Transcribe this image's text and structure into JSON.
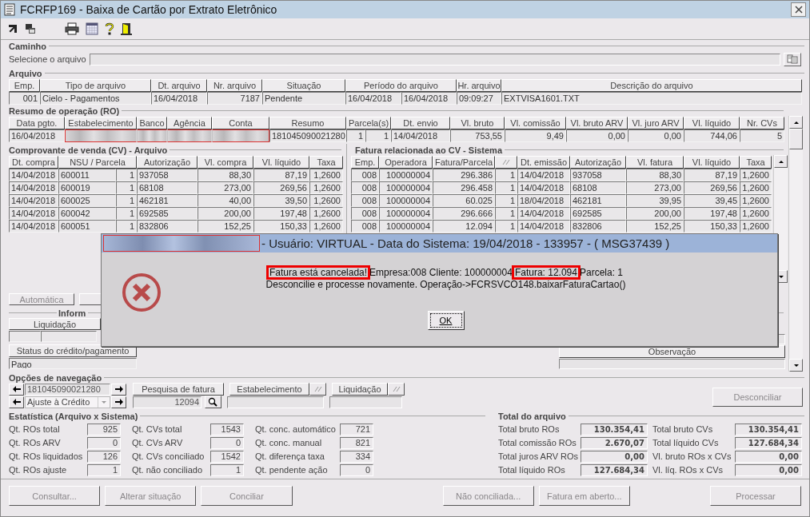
{
  "window": {
    "title": "FCRFP169 - Baixa de Cartão por Extrato Eletrônico"
  },
  "caminho": {
    "title": "Caminho",
    "label": "Selecione o arquivo"
  },
  "arquivo": {
    "title": "Arquivo",
    "columns": [
      "Emp.",
      "Tipo de arquivo",
      "Dt. arquivo",
      "Nr. arquivo",
      "Situação",
      "Período do arquivo",
      "Hr. arquivo",
      "Descrição do arquivo"
    ],
    "row": [
      "001",
      "Cielo - Pagamentos",
      "16/04/2018",
      "7187",
      "Pendente",
      [
        "16/04/2018",
        "16/04/2018"
      ],
      "09:09:27",
      "EXTVISA1601.TXT"
    ]
  },
  "resumo": {
    "title": "Resumo de operação (RO)",
    "columns": [
      "Data pgto.",
      "Estabelecimento",
      "Banco",
      "Agência",
      "Conta",
      "Resumo",
      "Parcela(s)",
      "Dt. envio",
      "Vl. bruto",
      "Vl. comissão",
      "Vl. bruto ARV",
      "Vl. juro ARV",
      "Vl. líquido",
      "Nr. CVs"
    ],
    "row": [
      {
        "kind": "text",
        "text": "16/04/2018"
      },
      {
        "kind": "redacted"
      },
      {
        "kind": "redacted"
      },
      {
        "kind": "redacted"
      },
      {
        "kind": "redacted"
      },
      {
        "kind": "text",
        "text": "181045090021280"
      },
      {
        "kind": "pair",
        "texts": [
          "1",
          "1"
        ]
      },
      {
        "kind": "text",
        "text": "14/04/2018"
      },
      {
        "kind": "text",
        "text": "753,55"
      },
      {
        "kind": "text",
        "text": "9,49"
      },
      {
        "kind": "text",
        "text": "0,00"
      },
      {
        "kind": "text",
        "text": "0,00"
      },
      {
        "kind": "text",
        "text": "744,06"
      },
      {
        "kind": "text",
        "text": "5"
      }
    ]
  },
  "cv": {
    "title": "Comprovante de venda (CV) - Arquivo",
    "columns": [
      "Dt. compra",
      "NSU / Parcela",
      "Autorização",
      "Vl. compra",
      "Vl. líquido",
      "Taxa"
    ],
    "rows": [
      [
        "14/04/2018",
        [
          "600011",
          "1"
        ],
        "937058",
        "88,30",
        "87,19",
        "1,2600"
      ],
      [
        "14/04/2018",
        [
          "600019",
          "1"
        ],
        "68108",
        "273,00",
        "269,56",
        "1,2600"
      ],
      [
        "14/04/2018",
        [
          "600025",
          "1"
        ],
        "462181",
        "40,00",
        "39,50",
        "1,2600"
      ],
      [
        "14/04/2018",
        [
          "600042",
          "1"
        ],
        "692585",
        "200,00",
        "197,48",
        "1,2600"
      ],
      [
        "14/04/2018",
        [
          "600051",
          "1"
        ],
        "832806",
        "152,25",
        "150,33",
        "1,2600"
      ]
    ]
  },
  "fatura": {
    "title": "Fatura relacionada ao CV - Sistema",
    "columns": [
      {
        "kind": "text",
        "label": "Emp."
      },
      {
        "kind": "text",
        "label": "Operadora"
      },
      {
        "kind": "text",
        "label": "Fatura/Parcela"
      },
      {
        "kind": "icon"
      },
      {
        "kind": "text",
        "label": "Dt. emissão"
      },
      {
        "kind": "text",
        "label": "Autorização"
      },
      {
        "kind": "text",
        "label": "Vl. fatura"
      },
      {
        "kind": "text",
        "label": "Vl. líquido"
      },
      {
        "kind": "text",
        "label": "Taxa"
      }
    ],
    "rows": [
      [
        "008",
        "100000004",
        "296.386",
        "1",
        "14/04/2018",
        "937058",
        "88,30",
        "87,19",
        "1,2600"
      ],
      [
        "008",
        "100000004",
        "296.458",
        "1",
        "14/04/2018",
        "68108",
        "273,00",
        "269,56",
        "1,2600"
      ],
      [
        "008",
        "100000004",
        "60.025",
        "1",
        "18/04/2018",
        "462181",
        "39,95",
        "39,45",
        "1,2600"
      ],
      [
        "008",
        "100000004",
        "296.666",
        "1",
        "14/04/2018",
        "692585",
        "200,00",
        "197,48",
        "1,2600"
      ],
      [
        "008",
        "100000004",
        "12.094",
        "1",
        "14/04/2018",
        "832806",
        "152,25",
        "150,33",
        "1,2600"
      ]
    ]
  },
  "automatica": {
    "label": "Automática",
    "disabled": true
  },
  "informacoes": {
    "title": "Inform",
    "liquidacao": "Liquidação",
    "status_header": "Status do crédito/pagamento",
    "status_value": "Pago",
    "observacao": "Observação"
  },
  "navegacao": {
    "title": "Opções de navegação",
    "resumo_value": "181045090021280",
    "tipo_value": "Ajuste à Crédito",
    "pesquisa_label": "Pesquisa de fatura",
    "pesquisa_value": "12094",
    "estabelecimento_label": "Estabelecimento",
    "liquidacao_label": "Liquidação"
  },
  "desconciliar": {
    "label": "Desconciliar",
    "disabled": true
  },
  "estatistica": {
    "title": "Estatística (Arquivo x Sistema)",
    "columns": [
      [
        {
          "label": "Qt. ROs total",
          "value": "925"
        },
        {
          "label": "Qt. ROs ARV",
          "value": "0"
        },
        {
          "label": "Qt. ROs liquidados",
          "value": "126"
        },
        {
          "label": "Qt. ROs ajuste",
          "value": "1"
        }
      ],
      [
        {
          "label": "Qt. CVs total",
          "value": "1543"
        },
        {
          "label": "Qt. CVs ARV",
          "value": "0"
        },
        {
          "label": "Qt. CVs conciliado",
          "value": "1542"
        },
        {
          "label": "Qt. não conciliado",
          "value": "1"
        }
      ],
      [
        {
          "label": "Qt. conc. automático",
          "value": "721"
        },
        {
          "label": "Qt. conc. manual",
          "value": "821"
        },
        {
          "label": "Qt. diferença taxa",
          "value": "334"
        },
        {
          "label": "Qt. pendente ação",
          "value": "0"
        }
      ]
    ]
  },
  "total": {
    "title": "Total do arquivo",
    "columns": [
      [
        {
          "label": "Total bruto ROs",
          "value": "130.354,41"
        },
        {
          "label": "Total comissão ROs",
          "value": "2.670,07"
        },
        {
          "label": "Total juros ARV ROs",
          "value": "0,00"
        },
        {
          "label": "Total líquido ROs",
          "value": "127.684,34"
        }
      ],
      [
        {
          "label": "Total bruto CVs",
          "value": "130.354,41"
        },
        {
          "label": "Total líquido CVs",
          "value": "127.684,34"
        },
        {
          "label": "Vl. bruto ROs x CVs",
          "value": "0,00"
        },
        {
          "label": "Vl. líq. ROs x CVs",
          "value": "0,00"
        }
      ]
    ]
  },
  "buttons": [
    {
      "label": "Consultar...",
      "disabled": true
    },
    {
      "label": "Alterar situação",
      "disabled": true
    },
    {
      "label": "Conciliar",
      "disabled": true
    },
    {
      "label": "Não conciliada...",
      "disabled": true
    },
    {
      "label": "Fatura em aberto...",
      "disabled": true
    },
    {
      "label": "Processar",
      "disabled": true
    }
  ],
  "dialog": {
    "title": "- Usuário: VIRTUAL - Data do Sistema: 19/04/2018 - 133957 - ( MSG37439 )",
    "line1": [
      {
        "text": "Fatura está cancelada!",
        "highlighted": true
      },
      {
        "text": "Empresa:008 Cliente: 100000004",
        "highlighted": false
      },
      {
        "text": "Fatura: 12.094",
        "highlighted": true
      },
      {
        "text": "Parcela: 1",
        "highlighted": false
      }
    ],
    "line2": "Desconcilie e processe novamente. Operação->FCRSVCO148.baixarFaturaCartao()",
    "ok": "OK"
  }
}
